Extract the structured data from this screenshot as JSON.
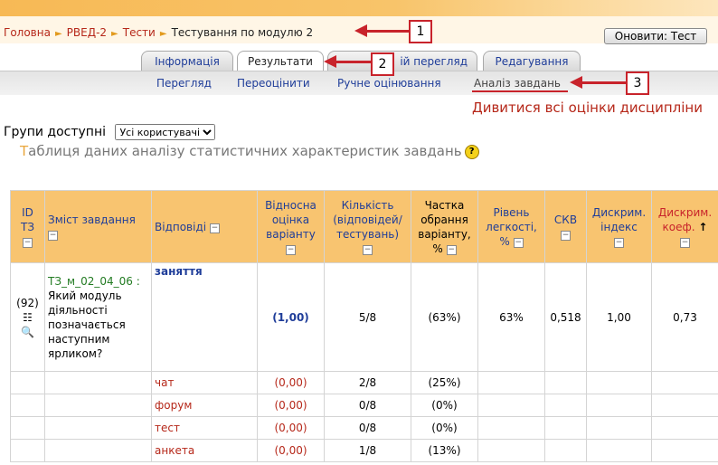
{
  "breadcrumb": {
    "items": [
      "Головна",
      "РВЕД-2",
      "Тести"
    ],
    "current": "Тестування по модулю 2",
    "separator": "►"
  },
  "update_button": "Оновити: Тест",
  "tabs": [
    "Інформація",
    "Результати",
    "Попередній перегляд",
    "Редагування"
  ],
  "tab_overlay_text": "ій перегляд",
  "subtabs": [
    "Перегляд",
    "Переоцінити",
    "Ручне оцінювання",
    "Аналіз завдань"
  ],
  "view_all_link": "Дивитися всі оцінки дисципліни",
  "groups": {
    "label": "Групи доступні",
    "selected": "Усі користувачі"
  },
  "table_title_first": "Т",
  "table_title_rest": "аблиця даних аналізу статистичних характеристик завдань",
  "help_icon": "?",
  "collapse_icon": "−",
  "sort_arrow": "↑",
  "columns": {
    "id": [
      "ID",
      "ТЗ"
    ],
    "content": "Зміст завдання",
    "answers": "Відповіді",
    "rel_grade": [
      "Відносна",
      "оцінка",
      "варіанту"
    ],
    "count": [
      "Кількість",
      "(відповідей/",
      "тестувань)"
    ],
    "share": [
      "Частка",
      "обрання",
      "варіанту,",
      "%"
    ],
    "easiness": [
      "Рівень",
      "легкості,",
      "%"
    ],
    "sd": "СКВ",
    "disc_index": [
      "Дискрим.",
      "індекс"
    ],
    "disc_coef": [
      "Дискрим.",
      "коеф."
    ]
  },
  "question": {
    "id": "(92)",
    "code": "ТЗ_м_02_04_06 :",
    "text": "Який модуль діяльності позначається наступним ярликом?",
    "easiness": "63%",
    "sd": "0,518",
    "disc_index": "1,00",
    "disc_coef": "0,73"
  },
  "answers": [
    {
      "text": "заняття",
      "grade": "(1,00)",
      "count": "5/8",
      "share": "(63%)"
    },
    {
      "text": "чат",
      "grade": "(0,00)",
      "count": "2/8",
      "share": "(25%)"
    },
    {
      "text": "форум",
      "grade": "(0,00)",
      "count": "0/8",
      "share": "(0%)"
    },
    {
      "text": "тест",
      "grade": "(0,00)",
      "count": "0/8",
      "share": "(0%)"
    },
    {
      "text": "анкета",
      "grade": "(0,00)",
      "count": "1/8",
      "share": "(13%)"
    }
  ],
  "callouts": [
    "1",
    "2",
    "3"
  ],
  "colors": {
    "annotation_red": "#c8232b",
    "header_orange": "#f8c470",
    "link_blue": "#1f3d99",
    "link_red": "#b6281a"
  }
}
